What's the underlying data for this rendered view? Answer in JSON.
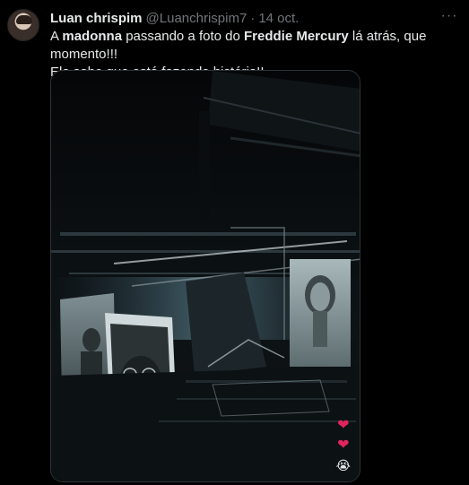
{
  "tweet": {
    "author_name": "Luan chrispim",
    "handle": "@Luanchrispim7",
    "separator": "·",
    "date": "14 oct.",
    "more_label": "···",
    "text": {
      "part1": "A ",
      "bold1": "madonna",
      "part2": " passando a foto do ",
      "bold2": "Freddie Mercury",
      "part3": " lá atrás, que momento!!!",
      "line2": "Ela sabe que está fazendo história!!"
    },
    "media": {
      "reactions": [
        "❤",
        "❤",
        "😭"
      ]
    }
  },
  "colors": {
    "background": "#000000",
    "text_primary": "#e7e9ea",
    "text_secondary": "#71767b",
    "border": "#2f3336",
    "heart": "#e0245e"
  }
}
